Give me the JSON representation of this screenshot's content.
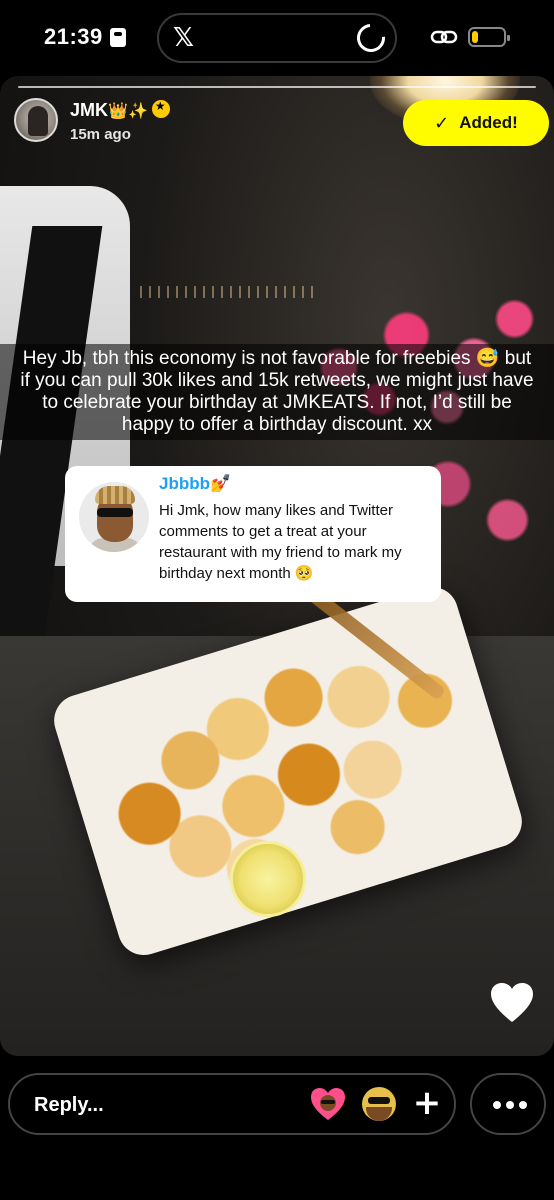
{
  "status_bar": {
    "time": "21:39",
    "island_app_icon": "x-logo",
    "island_app_glyph": "𝕏",
    "battery_level_percent": 20,
    "battery_color": "#ffcc00"
  },
  "story": {
    "user": {
      "name": "JMK",
      "name_emojis": [
        "crown-emoji",
        "sparkles-emoji"
      ],
      "crown_glyph": "👑",
      "sparkle_glyph": "✨",
      "timestamp": "15m ago"
    },
    "added_button": {
      "label": "Added!",
      "icon": "check-icon",
      "icon_glyph": "✓",
      "color": "#fffc00"
    },
    "caption": "Hey Jb, tbh this economy is not favorable for freebies 😅 but if you can pull 30k likes and 15k retweets, we might just have to celebrate your birthday at JMKEATS. If not, I’d still be happy to offer a birthday discount. xx",
    "reply_card": {
      "name": "Jbbbb💅",
      "text": "Hi Jmk, how many likes and Twitter comments to get a treat at your restaurant with my friend to mark my birthday next month 🥺"
    }
  },
  "bottom_bar": {
    "reply_placeholder": "Reply...",
    "quick_reactions": [
      "heart-face-icon",
      "bitmoji-face-icon"
    ],
    "plus_glyph": "+",
    "more_icon": "ellipsis-icon"
  }
}
